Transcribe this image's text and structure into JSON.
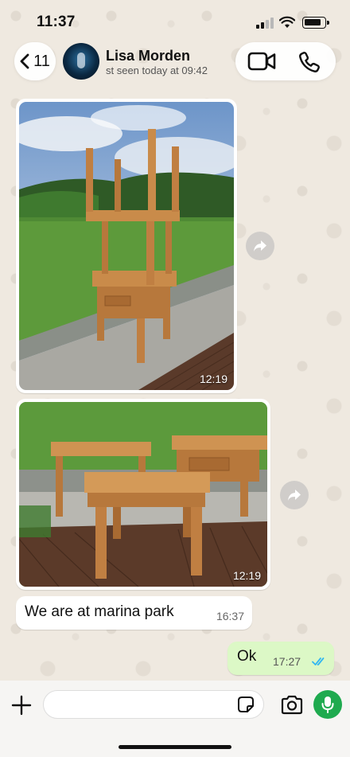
{
  "status_bar": {
    "time": "11:37"
  },
  "header": {
    "back_count": "11",
    "contact_name": "Lisa Morden",
    "contact_status": "st seen today at 09:42",
    "icons": [
      "chevron-left-icon",
      "video-call-icon",
      "phone-icon"
    ]
  },
  "messages": [
    {
      "type": "image",
      "direction": "in",
      "time": "12:19",
      "description_icon": "photo"
    },
    {
      "type": "image",
      "direction": "in",
      "time": "12:19",
      "description_icon": "photo"
    },
    {
      "type": "text",
      "direction": "in",
      "text": "We are at marina park",
      "time": "16:37"
    },
    {
      "type": "text",
      "direction": "out",
      "text": "Ok",
      "time": "17:27",
      "status": "read"
    }
  ],
  "input_bar": {
    "placeholder": "",
    "icons": [
      "plus-icon",
      "sticker-icon",
      "camera-icon",
      "microphone-icon"
    ]
  },
  "colors": {
    "outgoing_bubble": "#dcf8c6",
    "incoming_bubble": "#ffffff",
    "read_ticks": "#34b7f1",
    "mic_button": "#1faa4f",
    "wallpaper": "#efe9e0"
  }
}
